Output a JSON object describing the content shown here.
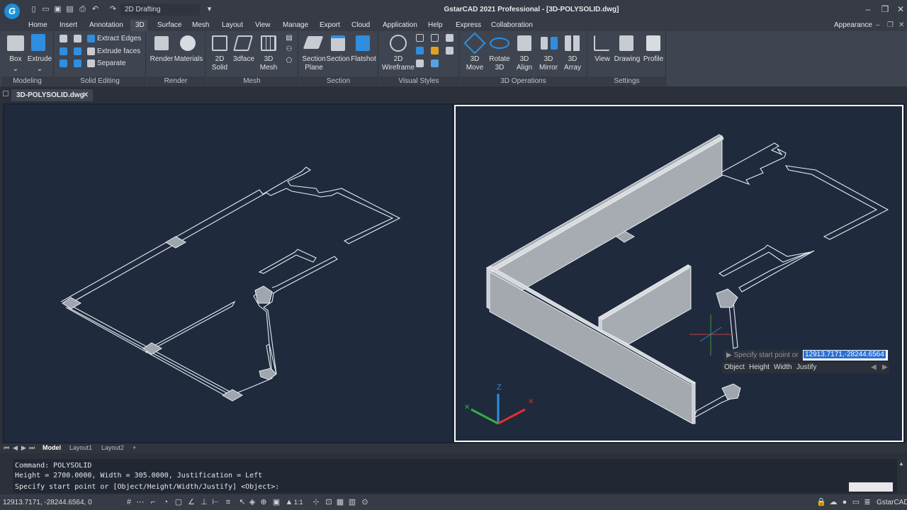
{
  "app": {
    "title": "GstarCAD 2021 Professional - [3D-POLYSOLID.dwg]",
    "logo": "G",
    "workspace": "2D Drafting"
  },
  "menu": [
    "Home",
    "Insert",
    "Annotation",
    "3D",
    "Surface",
    "Mesh",
    "Layout",
    "View",
    "Manage",
    "Export",
    "Cloud",
    "Application",
    "Help",
    "Express",
    "Collaboration"
  ],
  "appearance": "Appearance",
  "ribbon": {
    "modeling": {
      "title": "Modeling",
      "box": "Box",
      "extrude": "Extrude"
    },
    "solid_editing": {
      "title": "Solid Editing",
      "extract_edges": "Extract Edges",
      "extrude_faces": "Extrude faces",
      "separate": "Separate"
    },
    "render": {
      "title": "Render",
      "render": "Render",
      "materials": "Materials"
    },
    "mesh": {
      "title": "Mesh",
      "solid2d_a": "2D",
      "solid2d_b": "Solid",
      "face3d": "3dface",
      "mesh3d_a": "3D",
      "mesh3d_b": "Mesh"
    },
    "section": {
      "title": "Section",
      "plane_a": "Section",
      "plane_b": "Plane",
      "section": "Section",
      "flatshot": "Flatshot"
    },
    "visual_styles": {
      "title": "Visual Styles",
      "wire_a": "2D",
      "wire_b": "Wireframe"
    },
    "ops": {
      "title": "3D Operations",
      "move_a": "3D",
      "move_b": "Move",
      "rotate_a": "Rotate",
      "rotate_b": "3D",
      "align_a": "3D",
      "align_b": "Align",
      "mirror_a": "3D",
      "mirror_b": "Mirror",
      "array_a": "3D",
      "array_b": "Array"
    },
    "settings": {
      "title": "Settings",
      "view": "View",
      "drawing": "Drawing",
      "profile": "Profile"
    }
  },
  "file_tab": "3D-POLYSOLID.dwg",
  "tooltip": {
    "prompt": "Specify start point or",
    "value": "12913.7171,-28244.6564",
    "options": [
      "Object",
      "Height",
      "Width",
      "Justify"
    ]
  },
  "layout_tabs": [
    "Model",
    "Layout1",
    "Layout2",
    "+"
  ],
  "command_lines": [
    "Command: POLYSOLID",
    "Height = 2700.0000, Width = 305.0000, Justification = Left",
    "Specify start point or [Object/Height/Width/Justify] <Object>:"
  ],
  "status": {
    "coords": "12913.7171, -28244.6564, 0",
    "scale": "1:1",
    "product": "GstarCAD"
  },
  "ucs": {
    "z": "Z"
  }
}
